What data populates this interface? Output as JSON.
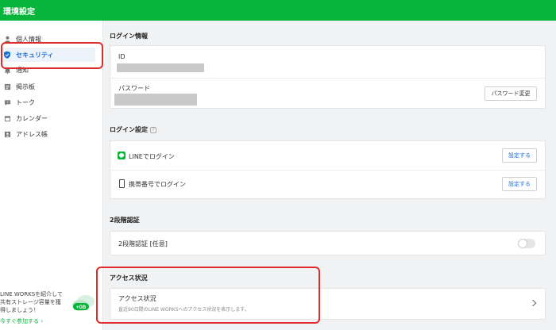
{
  "header": {
    "title": "環境設定"
  },
  "sidebar": {
    "items": [
      {
        "label": "個人情報"
      },
      {
        "label": "セキュリティ"
      },
      {
        "label": "通知"
      },
      {
        "label": "掲示板"
      },
      {
        "label": "トーク"
      },
      {
        "label": "カレンダー"
      },
      {
        "label": "アドレス帳"
      }
    ],
    "promo": {
      "text": "LINE WORKSを紹介して共有ストレージ容量を獲得しましょう！",
      "link": "今すぐ参加する ›",
      "badge": "+GB"
    }
  },
  "login_info": {
    "title": "ログイン情報",
    "id_label": "ID",
    "password_label": "パスワード",
    "change_password_button": "パスワード変更"
  },
  "login_settings": {
    "title": "ログイン設定",
    "help": "?",
    "line_login_label": "LINEでログイン",
    "phone_login_label": "携帯番号でログイン",
    "set_button": "設定する"
  },
  "two_factor": {
    "title": "2段階認証",
    "label": "2段階認証 [任意]",
    "enabled": false
  },
  "access": {
    "title": "アクセス状況",
    "label": "アクセス状況",
    "description": "直近90日間のLINE WORKSへのアクセス状況を表示します。"
  },
  "colors": {
    "brand_green": "#07b53b",
    "active_blue": "#1d6fd8",
    "highlight_red": "#e02b2b"
  }
}
